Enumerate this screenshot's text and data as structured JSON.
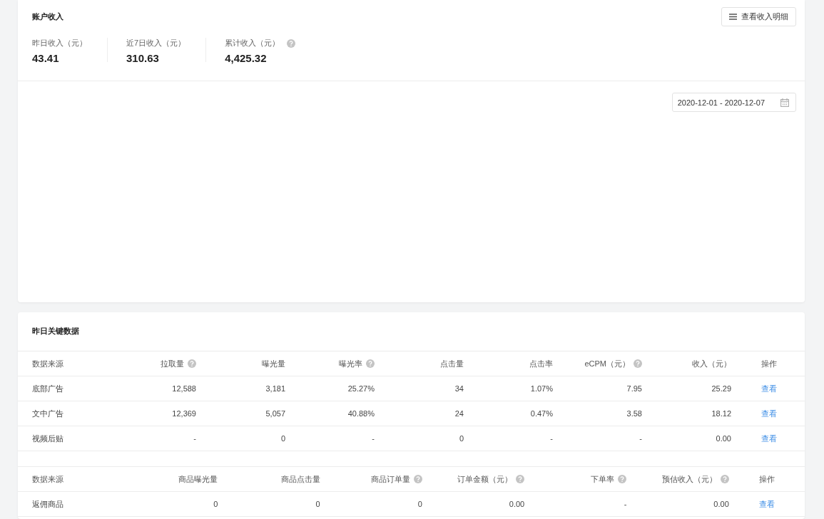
{
  "income_card": {
    "title": "账户收入",
    "detail_button": "查看收入明细",
    "stats": [
      {
        "label": "昨日收入（元）",
        "value": "43.41",
        "help": false
      },
      {
        "label": "近7日收入（元）",
        "value": "310.63",
        "help": false
      },
      {
        "label": "累计收入（元）",
        "value": "4,425.32",
        "help": true
      }
    ],
    "date_range": "2020-12-01 - 2020-12-07"
  },
  "key_data_card": {
    "title": "昨日关键数据",
    "tables": [
      {
        "kind": "ads",
        "columns": [
          {
            "label": "数据来源",
            "help": false
          },
          {
            "label": "拉取量",
            "help": true
          },
          {
            "label": "曝光量",
            "help": false
          },
          {
            "label": "曝光率",
            "help": true
          },
          {
            "label": "点击量",
            "help": false
          },
          {
            "label": "点击率",
            "help": false
          },
          {
            "label": "eCPM（元）",
            "help": true
          },
          {
            "label": "收入（元）",
            "help": false
          },
          {
            "label": "操作",
            "help": false
          }
        ],
        "rows": [
          [
            "底部广告",
            "12,588",
            "3,181",
            "25.27%",
            "34",
            "1.07%",
            "7.95",
            "25.29",
            "查看"
          ],
          [
            "文中广告",
            "12,369",
            "5,057",
            "40.88%",
            "24",
            "0.47%",
            "3.58",
            "18.12",
            "查看"
          ],
          [
            "视频后贴",
            "-",
            "0",
            "-",
            "0",
            "-",
            "-",
            "0.00",
            "查看"
          ]
        ]
      },
      {
        "kind": "goods",
        "columns": [
          {
            "label": "数据来源",
            "help": false
          },
          {
            "label": "商品曝光量",
            "help": false
          },
          {
            "label": "商品点击量",
            "help": false
          },
          {
            "label": "商品订单量",
            "help": true
          },
          {
            "label": "订单金额（元）",
            "help": true
          },
          {
            "label": "下单率",
            "help": true
          },
          {
            "label": "预估收入（元）",
            "help": true
          },
          {
            "label": "操作",
            "help": false
          }
        ],
        "rows": [
          [
            "返佣商品",
            "0",
            "0",
            "0",
            "0.00",
            "-",
            "0.00",
            "查看"
          ]
        ]
      }
    ]
  }
}
